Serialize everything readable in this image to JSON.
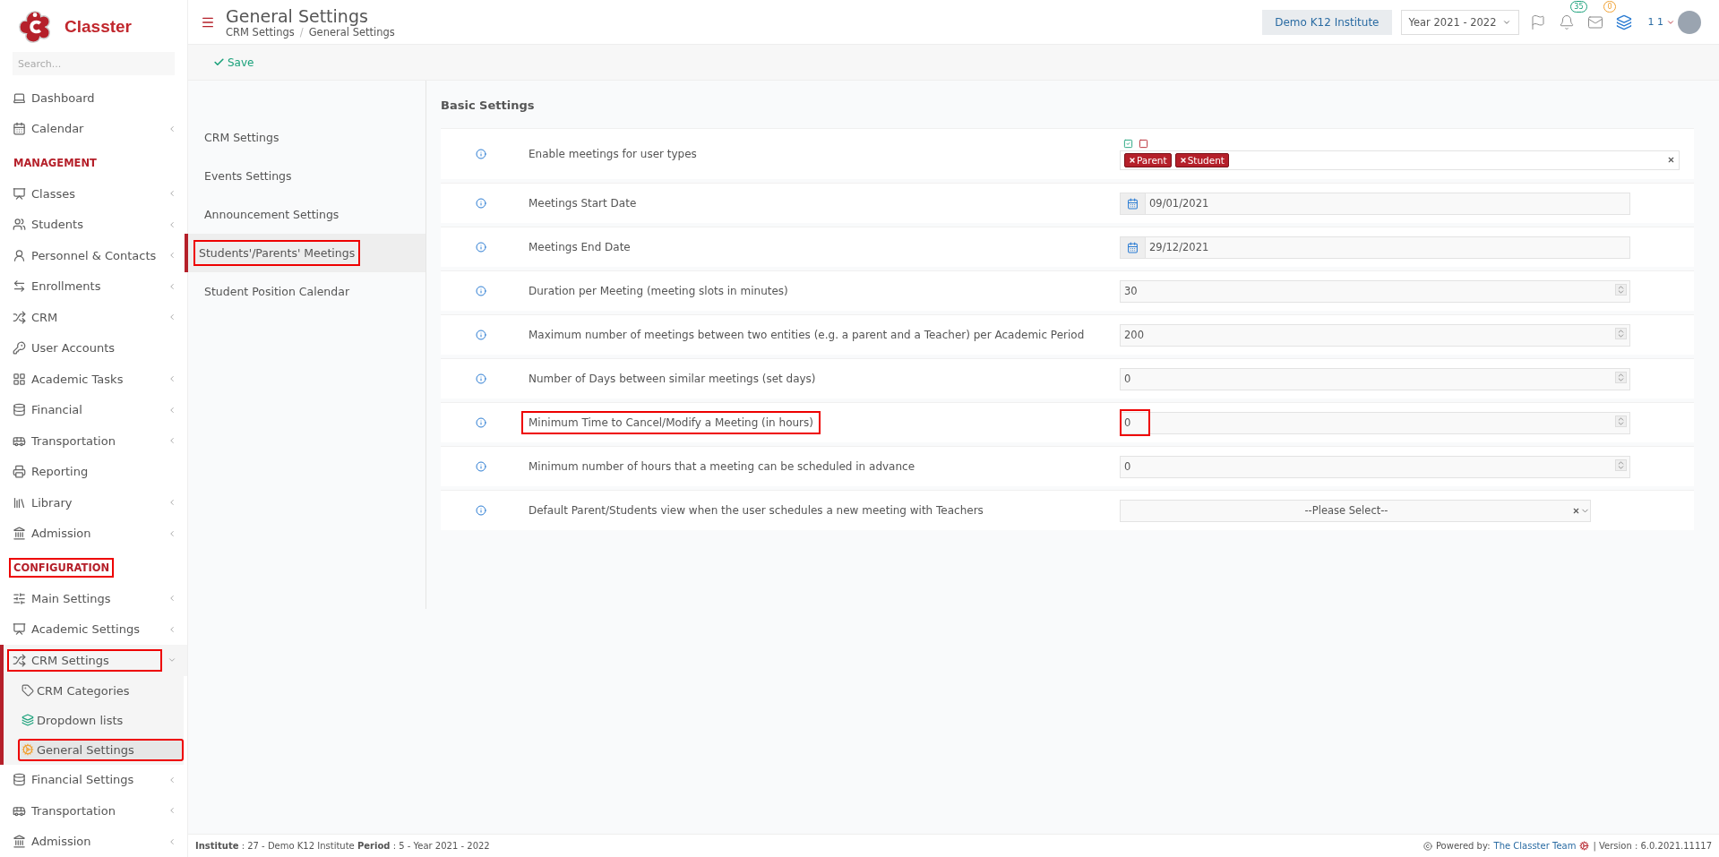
{
  "brand": {
    "name": "Classter"
  },
  "sidebar": {
    "search_placeholder": "Search...",
    "items": [
      {
        "kind": "link",
        "label": "Dashboard",
        "highlighted": false
      },
      {
        "kind": "menu",
        "label": "Calendar",
        "expanded": false,
        "highlighted": false
      },
      {
        "kind": "section",
        "label": "MANAGEMENT",
        "highlighted": false
      },
      {
        "kind": "menu",
        "label": "Classes",
        "expanded": false,
        "highlighted": false
      },
      {
        "kind": "menu",
        "label": "Students",
        "expanded": false,
        "highlighted": false
      },
      {
        "kind": "menu",
        "label": "Personnel & Contacts",
        "expanded": false,
        "highlighted": false
      },
      {
        "kind": "menu",
        "label": "Enrollments",
        "expanded": false,
        "highlighted": false
      },
      {
        "kind": "menu",
        "label": "CRM",
        "expanded": false,
        "highlighted": false
      },
      {
        "kind": "link",
        "label": "User Accounts",
        "highlighted": false
      },
      {
        "kind": "menu",
        "label": "Academic Tasks",
        "expanded": false,
        "highlighted": false
      },
      {
        "kind": "menu",
        "label": "Financial",
        "expanded": false,
        "highlighted": false
      },
      {
        "kind": "menu",
        "label": "Transportation",
        "expanded": false,
        "highlighted": false
      },
      {
        "kind": "link",
        "label": "Reporting",
        "highlighted": false
      },
      {
        "kind": "menu",
        "label": "Library",
        "expanded": false,
        "highlighted": false
      },
      {
        "kind": "menu",
        "label": "Admission",
        "expanded": false,
        "highlighted": false
      },
      {
        "kind": "section",
        "label": "CONFIGURATION",
        "highlighted": true
      },
      {
        "kind": "menu",
        "label": "Main Settings",
        "expanded": false,
        "highlighted": false
      },
      {
        "kind": "menu",
        "label": "Academic Settings",
        "expanded": false,
        "highlighted": false
      },
      {
        "kind": "menu",
        "label": "CRM Settings",
        "expanded": true,
        "highlighted": true,
        "children": [
          {
            "label": "CRM Categories",
            "selected": false,
            "highlighted": false
          },
          {
            "label": "Dropdown lists",
            "selected": false,
            "highlighted": false
          },
          {
            "label": "General Settings",
            "selected": true,
            "highlighted": true
          }
        ]
      },
      {
        "kind": "menu",
        "label": "Financial Settings",
        "expanded": false,
        "highlighted": false
      },
      {
        "kind": "menu",
        "label": "Transportation",
        "expanded": false,
        "highlighted": false
      },
      {
        "kind": "menu",
        "label": "Admission",
        "expanded": false,
        "highlighted": false
      }
    ]
  },
  "header": {
    "title": "General Settings",
    "breadcrumb": [
      "CRM Settings",
      "General Settings"
    ],
    "breadcrumb_separator": "/",
    "institute": "Demo K12 Institute",
    "year": "Year 2021 - 2022",
    "notifications": "35",
    "messages": "0",
    "user": "1 1"
  },
  "toolbar": {
    "save": "Save"
  },
  "settings_nav": [
    {
      "label": "CRM Settings",
      "selected": false,
      "highlighted": false
    },
    {
      "label": "Events Settings",
      "selected": false,
      "highlighted": false
    },
    {
      "label": "Announcement Settings",
      "selected": false,
      "highlighted": false
    },
    {
      "label": "Students'/Parents' Meetings",
      "selected": true,
      "highlighted": true
    },
    {
      "label": "Student Position Calendar",
      "selected": false,
      "highlighted": false
    }
  ],
  "section_title": "Basic Settings",
  "rows": [
    {
      "kind": "tags",
      "label": "Enable meetings for user types",
      "tags": [
        "Parent",
        "Student"
      ],
      "highlighted": false
    },
    {
      "kind": "date",
      "label": "Meetings Start Date",
      "value": "09/01/2021",
      "highlighted": false
    },
    {
      "kind": "date",
      "label": "Meetings End Date",
      "value": "29/12/2021",
      "highlighted": false
    },
    {
      "kind": "number",
      "label": "Duration per Meeting (meeting slots in minutes)",
      "value": "30",
      "highlighted": false
    },
    {
      "kind": "number",
      "label": "Maximum number of meetings between two entities (e.g. a parent and a Teacher) per Academic Period",
      "value": "200",
      "highlighted": false
    },
    {
      "kind": "number",
      "label": "Number of Days between similar meetings (set days)",
      "value": "0",
      "highlighted": false
    },
    {
      "kind": "number",
      "label": "Minimum Time to Cancel/Modify a Meeting (in hours)",
      "value": "0",
      "highlighted": true
    },
    {
      "kind": "number",
      "label": "Minimum number of hours that a meeting can be scheduled in advance",
      "value": "0",
      "highlighted": false
    },
    {
      "kind": "select",
      "label": "Default Parent/Students view when the user schedules a new meeting with Teachers",
      "placeholder": "--Please Select--",
      "highlighted": false
    }
  ],
  "footer": {
    "info": "**Institute** : 27 - Demo K12 Institute **Period** : 5 - Year 2021 - 2022",
    "powered": "Powered by:",
    "team": "The Classter Team",
    "version": "| Version : 6.0.2021.11117"
  }
}
